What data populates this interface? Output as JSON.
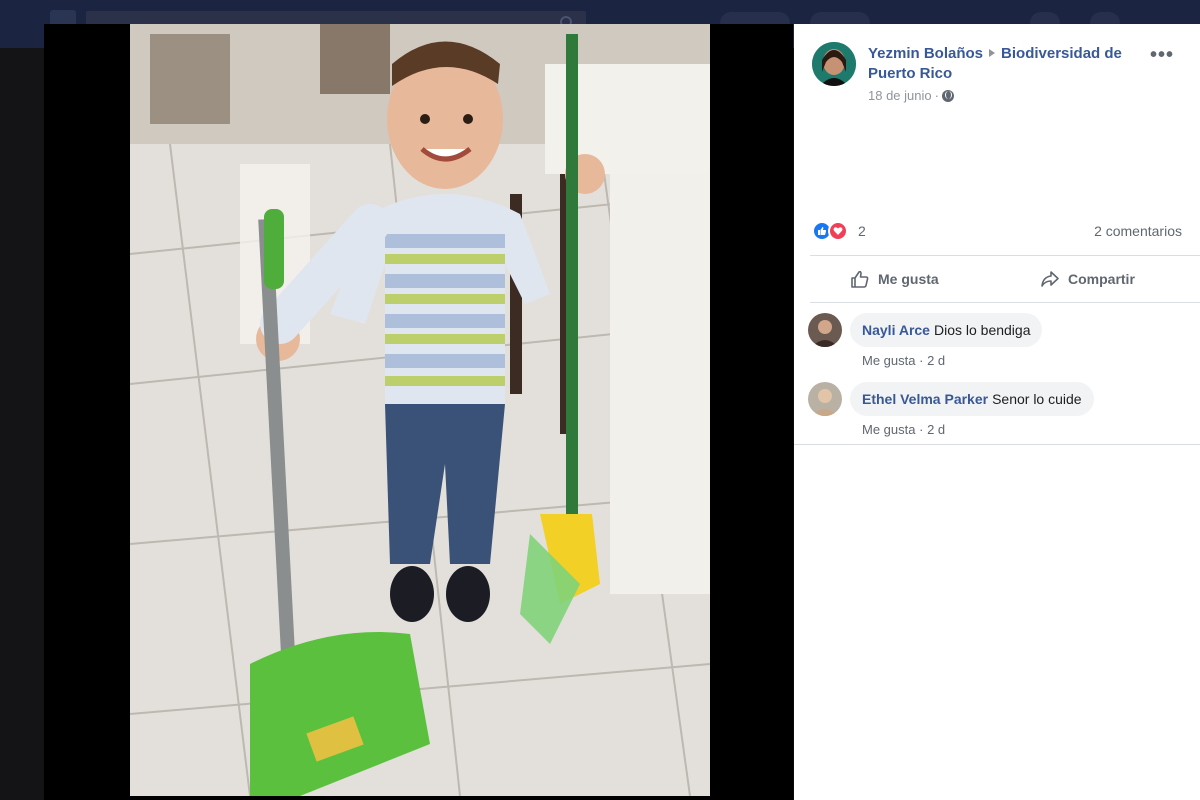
{
  "post": {
    "author": "Yezmin Bolaños",
    "group": "Biodiversidad de Puerto Rico",
    "date": "18 de junio",
    "date_separator": "·",
    "more": "•••"
  },
  "reactions": {
    "count": "2",
    "comments_label": "2 comentarios"
  },
  "actions": {
    "like_label": "Me gusta",
    "share_label": "Compartir"
  },
  "comments": [
    {
      "name": "Nayli Arce",
      "text": "Dios lo bendiga",
      "like": "Me gusta",
      "time": "2 d"
    },
    {
      "name": "Ethel Velma Parker",
      "text": "Senor lo cuide",
      "like": "Me gusta",
      "time": "2 d"
    }
  ],
  "colors": {
    "link": "#385898",
    "like_blue": "#1877f2",
    "love_red": "#f33e58",
    "panel_bg": "#ffffff",
    "stage_bg": "#000000"
  },
  "icons": {
    "like_reaction": "thumbs-up-icon",
    "love_reaction": "heart-icon",
    "share": "share-arrow-icon",
    "privacy": "globe-icon"
  }
}
